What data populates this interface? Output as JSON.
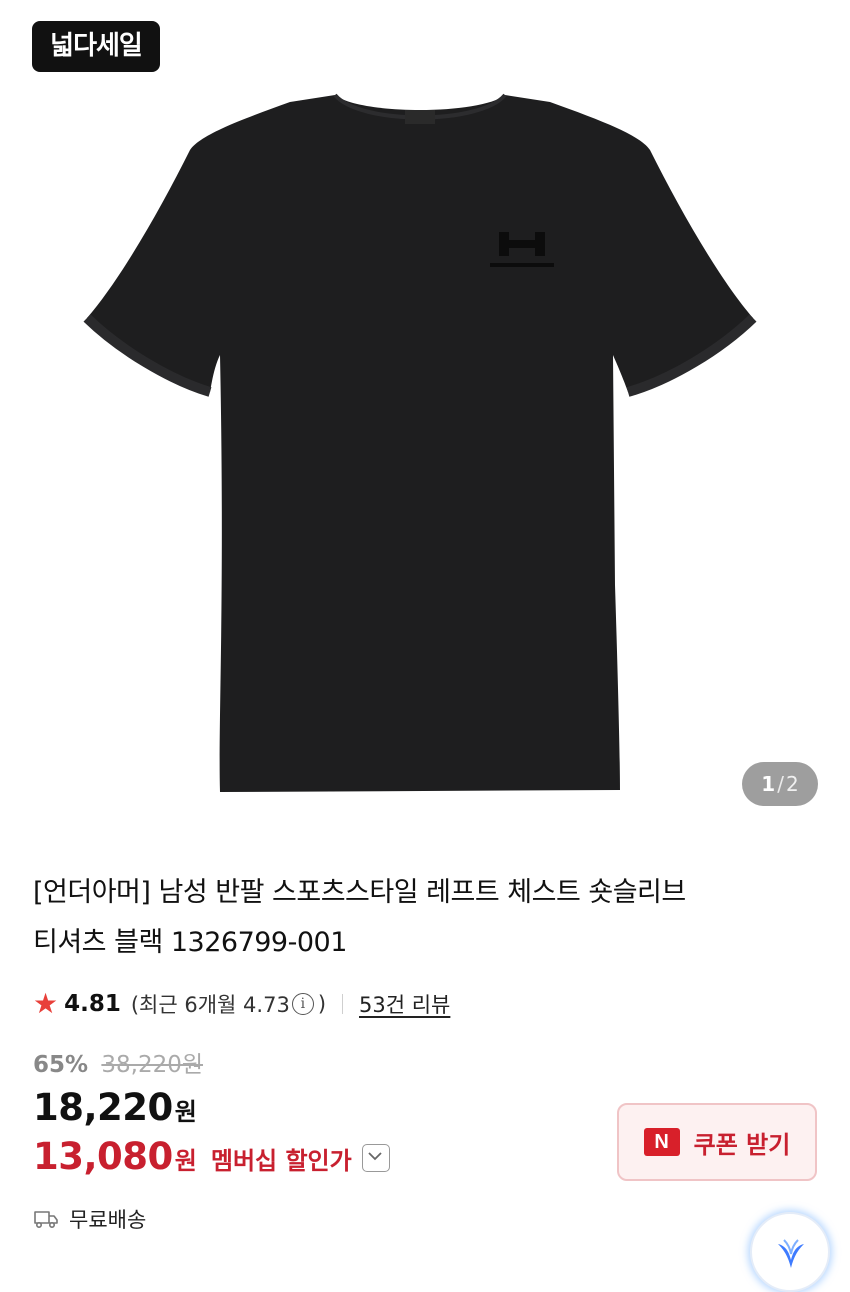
{
  "badge": {
    "label": "넓다세일"
  },
  "product_image": {
    "alt": "black t-shirt"
  },
  "pager": {
    "current": "1",
    "separator": "/",
    "total": "2"
  },
  "product": {
    "title_line1": "[언더아머] 남성 반팔 스포츠스타일 레프트 체스트 숏슬리브",
    "title_line2": "티셔츠 블랙 1326799-001"
  },
  "rating": {
    "score": "4.81",
    "recent_prefix": "(최근 6개월 4.73",
    "recent_suffix": ")",
    "info_glyph": "i",
    "reviews": "53건 리뷰"
  },
  "pricing": {
    "discount_rate": "65%",
    "original_price": "38,220원",
    "price": "18,220",
    "price_unit": "원",
    "member_price": "13,080",
    "member_unit": "원",
    "member_label": "멤버십 할인가"
  },
  "coupon": {
    "logo": "N",
    "label": "쿠폰 받기"
  },
  "shipping": {
    "label": "무료배송"
  },
  "colors": {
    "accent_red": "#c8202f",
    "star": "#e8403a",
    "naver_red": "#d8202a"
  }
}
